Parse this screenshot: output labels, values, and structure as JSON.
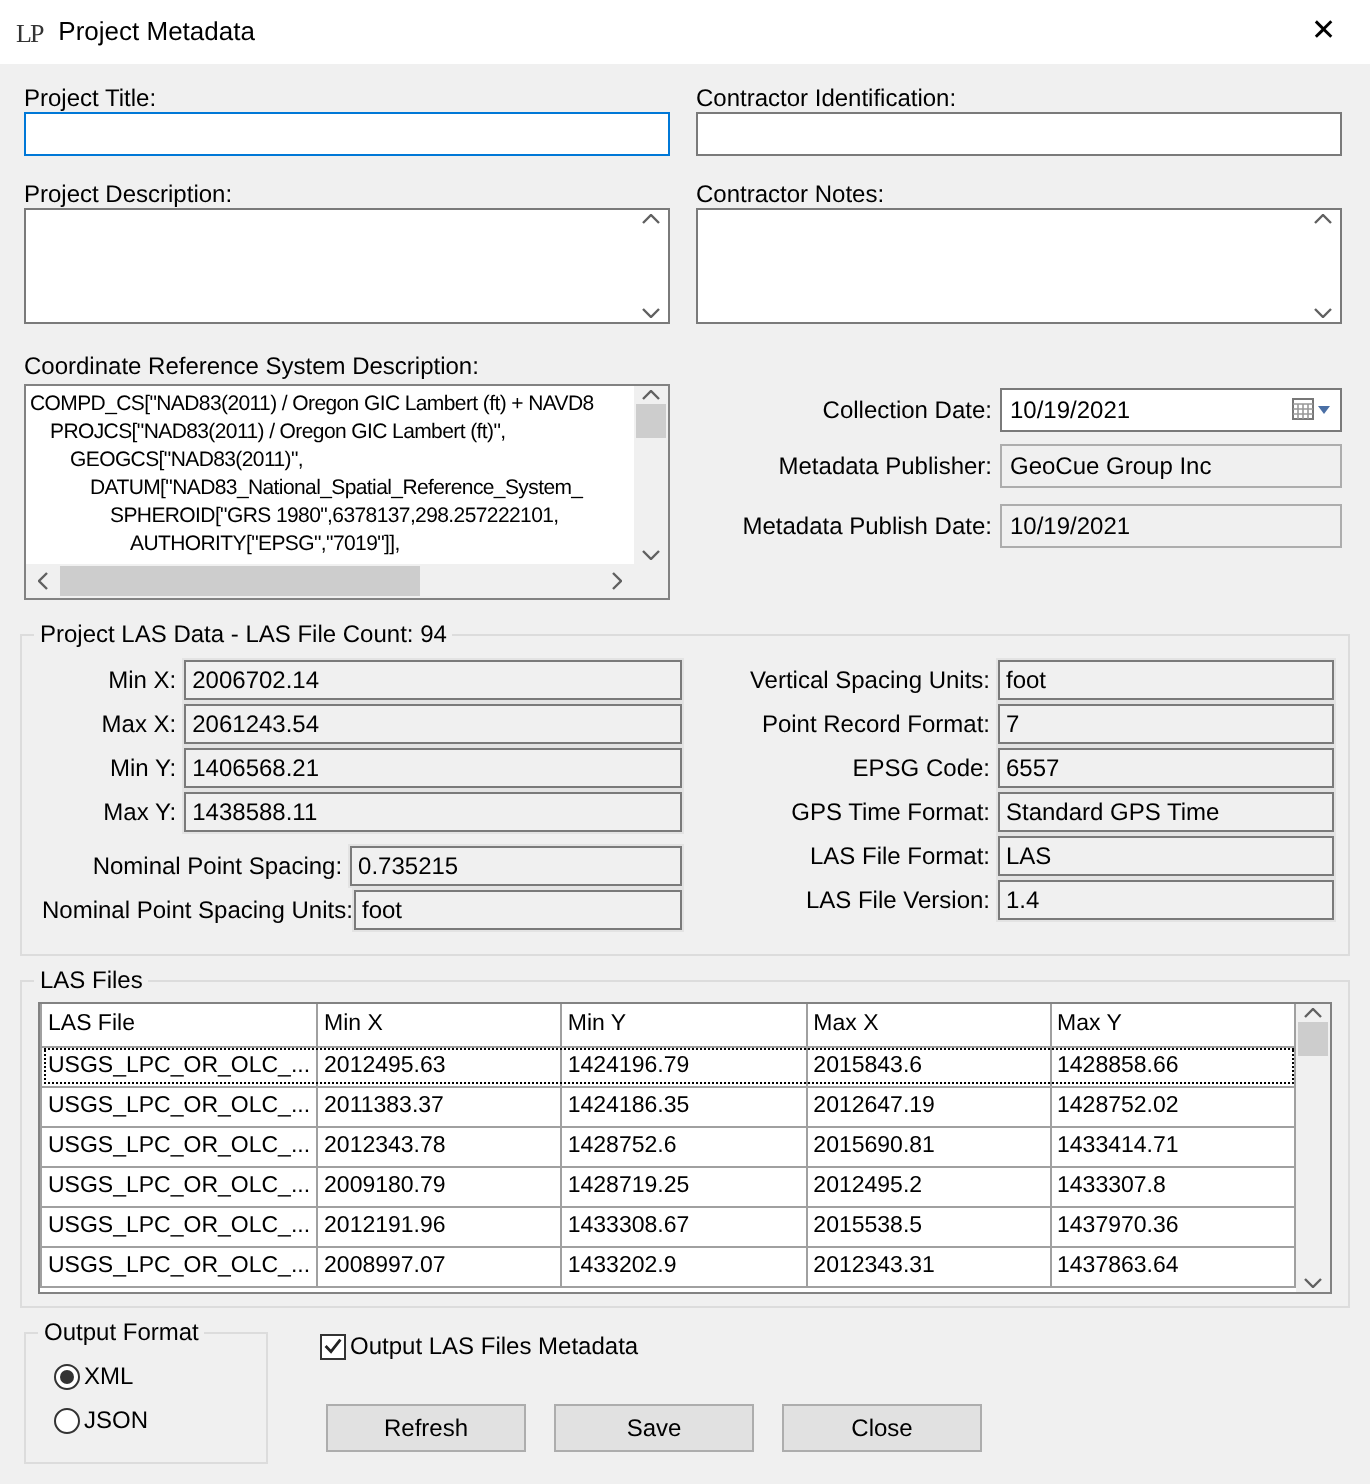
{
  "window": {
    "logo": "LP",
    "title": "Project Metadata",
    "close": "✕"
  },
  "project_title": {
    "label": "Project Title:",
    "focused": true
  },
  "contractor_identification": {
    "label": "Contractor Identification:",
    "focused": false
  },
  "project_description": {
    "label": "Project Description:"
  },
  "contractor_notes": {
    "label": "Contractor Notes:"
  },
  "crs_description": {
    "label": "Coordinate Reference System Description:",
    "lines": [
      {
        "text": "COMPD_CS[\"NAD83(2011) / Oregon GIC Lambert (ft) + NAVD8",
        "children": [
          {
            "text": "PROJCS[\"NAD83(2011) / Oregon GIC Lambert (ft)\",",
            "children": [
              {
                "text": "GEOGCS[\"NAD83(2011)\",",
                "children": [
                  {
                    "text": "DATUM[\"NAD83_National_Spatial_Reference_System_",
                    "children": [
                      {
                        "text": "SPHEROID[\"GRS 1980\",6378137,298.257222101,",
                        "children": [
                          {
                            "text": "AUTHORITY[\"EPSG\",\"7019\"]],"
                          }
                        ]
                      }
                    ]
                  }
                ]
              }
            ]
          }
        ]
      }
    ]
  },
  "date_fields": [
    {
      "label": "Collection Date:",
      "value": "10/19/2021",
      "kind": "date",
      "readonly": false
    },
    {
      "label": "Metadata Publisher:",
      "value": "GeoCue Group Inc",
      "kind": "text",
      "readonly": true
    },
    {
      "label": "Metadata Publish Date:",
      "value": "10/19/2021",
      "kind": "text",
      "readonly": true
    }
  ],
  "las_data": {
    "title": "Project LAS Data - LAS File Count: 94",
    "extent_fields": [
      {
        "label": "Min X:",
        "value": "2006702.14"
      },
      {
        "label": "Max X:",
        "value": "2061243.54"
      },
      {
        "label": "Min Y:",
        "value": "1406568.21"
      },
      {
        "label": "Max Y:",
        "value": "1438588.11"
      }
    ],
    "spacing_fields": [
      {
        "label": "Nominal Point Spacing:",
        "value": "0.735215"
      },
      {
        "label": "Nominal Point Spacing Units:",
        "value": "foot"
      }
    ],
    "format_fields": [
      {
        "label": "Vertical Spacing Units:",
        "value": "foot"
      },
      {
        "label": "Point Record Format:",
        "value": "7"
      },
      {
        "label": "EPSG Code:",
        "value": "6557"
      },
      {
        "label": "GPS Time Format:",
        "value": "Standard GPS Time"
      },
      {
        "label": "LAS File Format:",
        "value": "LAS"
      },
      {
        "label": "LAS File Version:",
        "value": "1.4"
      }
    ]
  },
  "las_files": {
    "title": "LAS Files",
    "columns": [
      "LAS File",
      "Min X",
      "Min Y",
      "Max X",
      "Max Y"
    ],
    "rows": [
      {
        "cells": [
          "USGS_LPC_OR_OLC_...",
          "2012495.63",
          "1424196.79",
          "2015843.6",
          "1428858.66"
        ],
        "focused": true
      },
      {
        "cells": [
          "USGS_LPC_OR_OLC_...",
          "2011383.37",
          "1424186.35",
          "2012647.19",
          "1428752.02"
        ],
        "focused": false
      },
      {
        "cells": [
          "USGS_LPC_OR_OLC_...",
          "2012343.78",
          "1428752.6",
          "2015690.81",
          "1433414.71"
        ],
        "focused": false
      },
      {
        "cells": [
          "USGS_LPC_OR_OLC_...",
          "2009180.79",
          "1428719.25",
          "2012495.2",
          "1433307.8"
        ],
        "focused": false
      },
      {
        "cells": [
          "USGS_LPC_OR_OLC_...",
          "2012191.96",
          "1433308.67",
          "2015538.5",
          "1437970.36"
        ],
        "focused": false
      },
      {
        "cells": [
          "USGS_LPC_OR_OLC_...",
          "2008997.07",
          "1433202.9",
          "2012343.31",
          "1437863.64"
        ],
        "focused": false
      }
    ]
  },
  "output_format": {
    "title": "Output Format",
    "options": [
      {
        "label": "XML",
        "selected": true
      },
      {
        "label": "JSON",
        "selected": false
      }
    ]
  },
  "output_las_files_metadata": {
    "label": "Output LAS Files Metadata",
    "checked": true
  },
  "buttons": [
    "Refresh",
    "Save",
    "Close"
  ]
}
